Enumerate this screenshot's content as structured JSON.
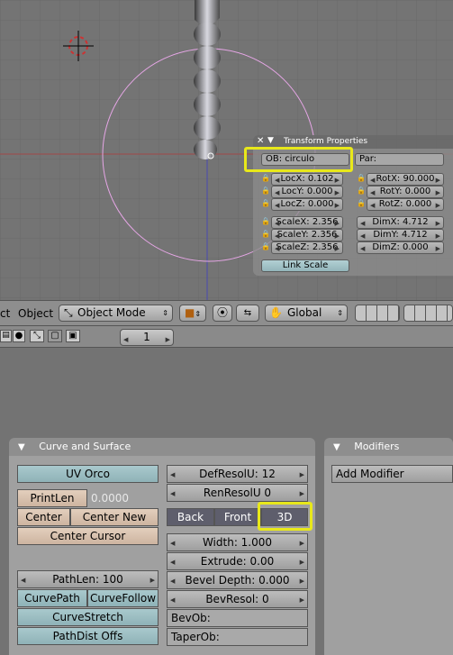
{
  "transform_panel": {
    "title": "Transform Properties",
    "ob": "OB: circulo",
    "par": "Par:",
    "loc": [
      "LocX: 0.102",
      "LocY: 0.000",
      "LocZ: 0.000"
    ],
    "rot": [
      "RotX: 90.000",
      "RotY: 0.000",
      "RotZ: 0.000"
    ],
    "scale": [
      "ScaleX: 2.356",
      "ScaleY: 2.356",
      "ScaleZ: 2.356"
    ],
    "dim": [
      "DimX: 4.712",
      "DimY: 4.712",
      "DimZ: 0.000"
    ],
    "link_scale": "Link Scale"
  },
  "header": {
    "ct": "ct",
    "object_menu": "Object",
    "mode": "Object Mode",
    "orientation": "Global"
  },
  "buttons_header": {
    "frame": "1"
  },
  "curve_panel": {
    "title": "Curve and Surface",
    "uv_orco": "UV Orco",
    "printlen": "PrintLen",
    "printlen_value": "0.0000",
    "center": "Center",
    "center_new": "Center New",
    "center_cursor": "Center Cursor",
    "pathlen": "PathLen: 100",
    "curvepath": "CurvePath",
    "curvefollow": "CurveFollow",
    "curvestretch": "CurveStretch",
    "pathdist": "PathDist Offs",
    "defresolu": "DefResolU: 12",
    "renresolu": "RenResolU 0",
    "back": "Back",
    "front": "Front",
    "three_d": "3D",
    "width": "Width: 1.000",
    "extrude": "Extrude: 0.00",
    "bevel_depth": "Bevel Depth: 0.000",
    "bevresol": "BevResol: 0",
    "bevob": "BevOb:",
    "taperob": "TaperOb:"
  },
  "modifiers_panel": {
    "title": "Modifiers",
    "add_modifier": "Add Modifier"
  },
  "colors": {
    "highlight": "#e8e81a",
    "circle": "#e6a6e6",
    "axis_red": "#b04040"
  }
}
